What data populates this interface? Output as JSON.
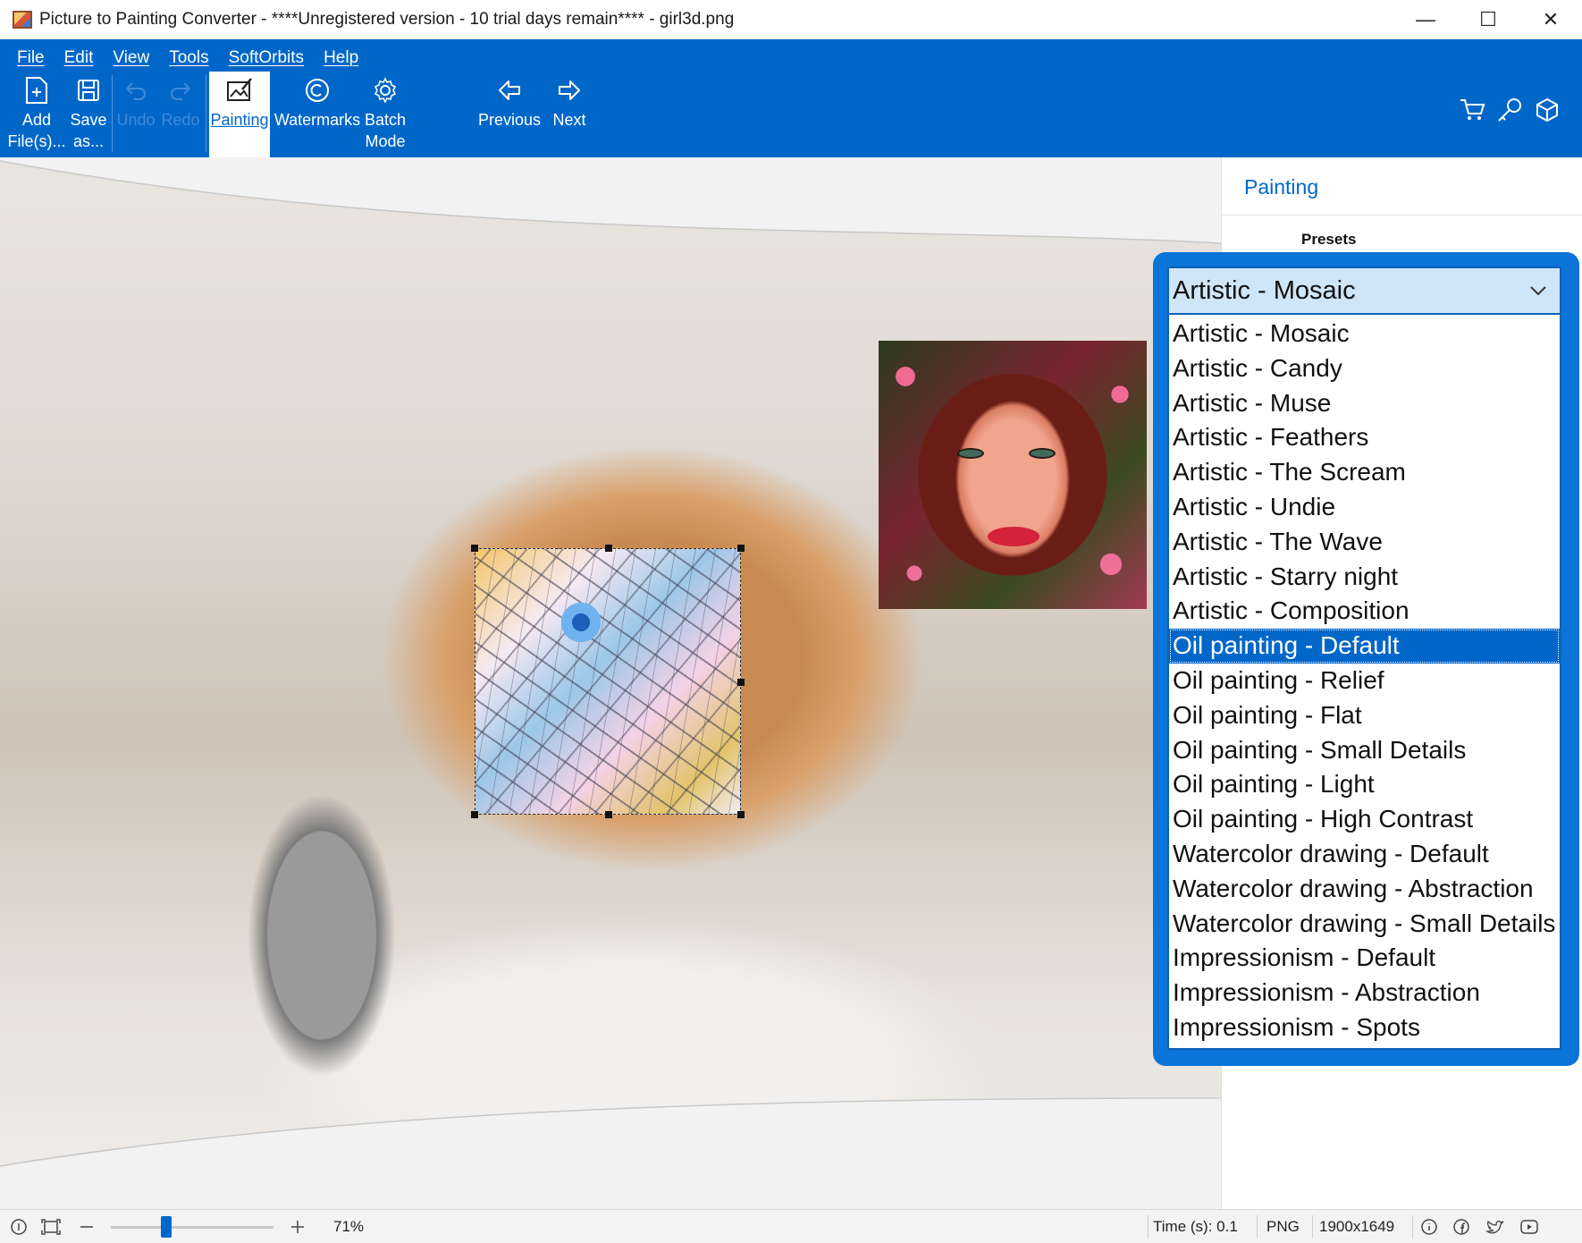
{
  "window": {
    "title": "Picture to Painting Converter - ****Unregistered version - 10 trial days remain**** - girl3d.png",
    "minimize": "—",
    "maximize": "☐",
    "close": "✕"
  },
  "menu": [
    "File",
    "Edit",
    "View",
    "Tools",
    "SoftOrbits",
    "Help"
  ],
  "toolbar": {
    "add_files": "Add\nFile(s)...",
    "save_as": "Save\nas...",
    "undo": "Undo",
    "redo": "Redo",
    "painting": "Painting",
    "watermarks": "Watermarks",
    "batch_mode": "Batch\nMode",
    "previous": "Previous",
    "next": "Next"
  },
  "panel": {
    "title": "Painting",
    "presets_label": "Presets"
  },
  "presets": {
    "selected_value": "Artistic - Mosaic",
    "highlighted": "Oil painting - Default",
    "options": [
      "Artistic - Mosaic",
      "Artistic - Candy",
      "Artistic - Muse",
      "Artistic - Feathers",
      "Artistic - The Scream",
      "Artistic - Undie",
      "Artistic - The Wave",
      "Artistic - Starry night",
      "Artistic - Composition",
      "Oil painting - Default",
      "Oil painting - Relief",
      "Oil painting - Flat",
      "Oil painting - Small Details",
      "Oil painting - Light",
      "Oil painting - High Contrast",
      "Watercolor drawing - Default",
      "Watercolor drawing - Abstraction",
      "Watercolor drawing - Small Details",
      "Impressionism - Default",
      "Impressionism - Abstraction",
      "Impressionism - Spots"
    ]
  },
  "statusbar": {
    "zoom_level": "71%",
    "zoom_fraction": 0.34,
    "time": "Time (s): 0.1",
    "format": "PNG",
    "dimensions": "1900x1649"
  },
  "colors": {
    "accent": "#0067c9",
    "callout": "#0a74d8",
    "dropdown_header": "#cfe6f8",
    "selected_item": "#0067c9"
  }
}
